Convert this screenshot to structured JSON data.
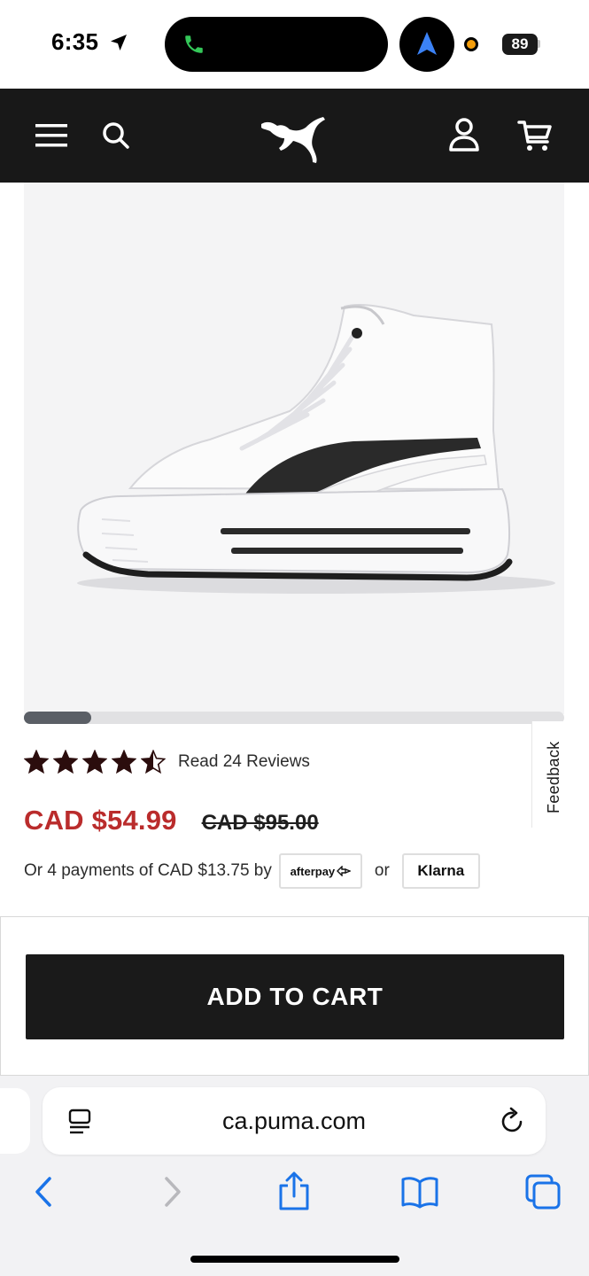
{
  "status_bar": {
    "time": "6:35",
    "battery": "89",
    "icons": [
      "location-arrow-icon",
      "phone-call-icon",
      "navigation-icon",
      "recording-dot-icon",
      "battery-icon"
    ]
  },
  "header": {
    "icons": [
      "menu-icon",
      "search-icon",
      "puma-logo",
      "account-icon",
      "cart-icon"
    ],
    "background": "#181818"
  },
  "product": {
    "image": "white high-top platform sneaker with black formstrip",
    "carousel_progress": 0.125,
    "rating": 4.5,
    "rating_max": 5,
    "reviews_label": "Read 24 Reviews",
    "sale_price": "CAD $54.99",
    "original_price": "CAD $95.00",
    "payment_text": "Or 4 payments of CAD $13.75 by",
    "afterpay_label": "afterpay",
    "or_label": "or",
    "klarna_label": "Klarna",
    "sale_color": "#ba2c2c"
  },
  "feedback": {
    "label": "Feedback"
  },
  "cart": {
    "button_label": "ADD TO CART"
  },
  "browser": {
    "url": "ca.puma.com",
    "toolbar_icons": [
      "back-icon",
      "forward-icon",
      "share-icon",
      "bookmarks-icon",
      "tabs-icon"
    ],
    "accent": "#1a73e8"
  }
}
